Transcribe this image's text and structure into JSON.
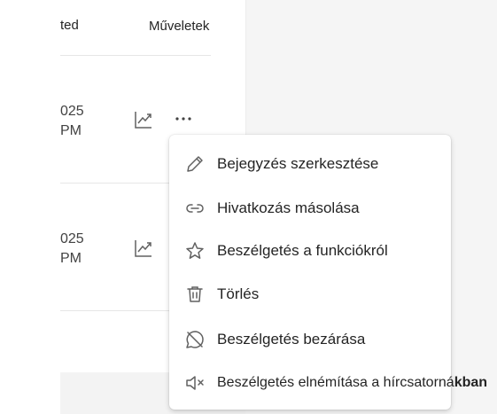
{
  "table": {
    "header_left": "ted",
    "header_right": "Műveletek",
    "rows": [
      {
        "date_line1": "025",
        "date_line2": "PM"
      },
      {
        "date_line1": "025",
        "date_line2": "PM"
      }
    ]
  },
  "menu": {
    "items": [
      {
        "label": "Bejegyzés szerkesztése",
        "icon": "pencil-icon"
      },
      {
        "label": "Hivatkozás másolása",
        "icon": "link-icon"
      },
      {
        "label": "Beszélgetés a funkciókról",
        "icon": "star-icon"
      },
      {
        "label": "Törlés",
        "icon": "trash-icon"
      },
      {
        "label": "Beszélgetés bezárása",
        "icon": "chat-off-icon"
      },
      {
        "label_main": "Beszélgetés elnémítása a hírcsatorná",
        "label_tail": "kban",
        "icon": "speaker-mute-icon"
      }
    ]
  },
  "colors": {
    "text": "#242424",
    "icon": "#616161",
    "menu_bg": "#ffffff",
    "pane_bg": "#f5f5f5"
  }
}
